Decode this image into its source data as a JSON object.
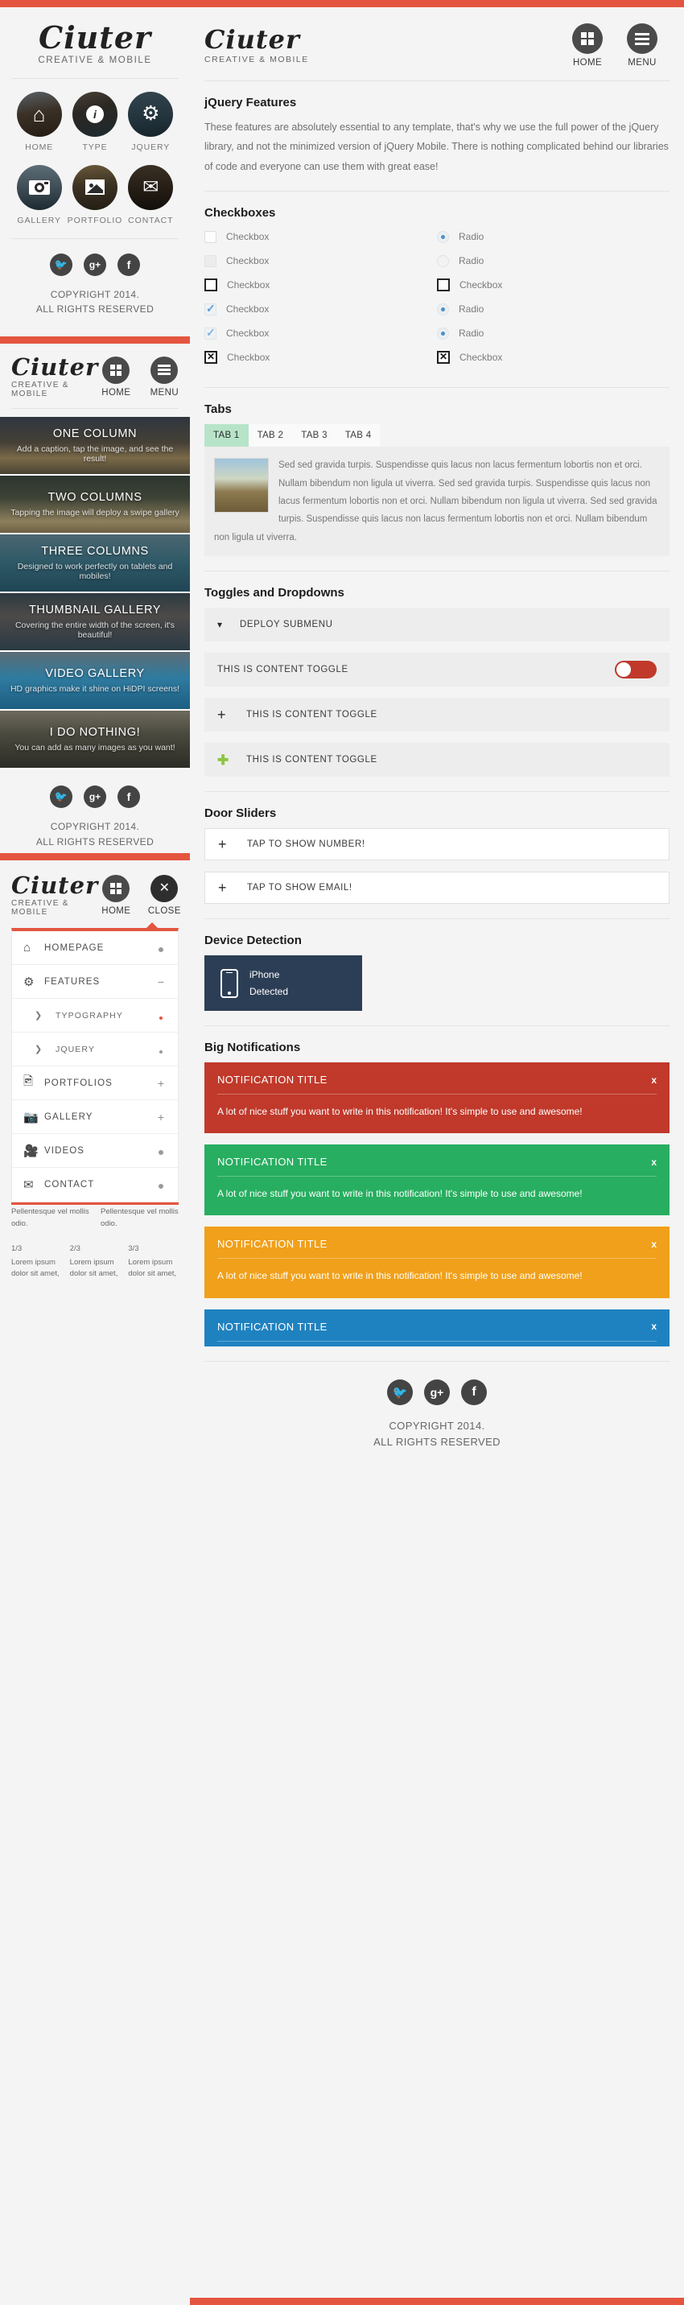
{
  "brand": {
    "name": "Ciuter",
    "tagline": "CREATIVE & MOBILE"
  },
  "colors": {
    "accent_red": "#e4553f",
    "notif_red": "#c0392b",
    "notif_green": "#27ae60",
    "notif_orange": "#f0a01a",
    "notif_blue": "#1f82c0",
    "tab_active_green": "#b7e4c9",
    "device_navy": "#2c3e55",
    "toggle_on_red": "#c0392b",
    "plus_green": "#8dc63f",
    "checkbox_blue": "#5b9bd5"
  },
  "page1": {
    "tiles": [
      {
        "label": "HOME",
        "icon": "home-icon",
        "glyph": "⌂"
      },
      {
        "label": "TYPE",
        "icon": "info-icon",
        "glyph": "i"
      },
      {
        "label": "JQUERY",
        "icon": "gear-icon",
        "glyph": "⚙"
      },
      {
        "label": "GALLERY",
        "icon": "camera-icon",
        "glyph": "▣"
      },
      {
        "label": "PORTFOLIO",
        "icon": "image-icon",
        "glyph": "⛰"
      },
      {
        "label": "CONTACT",
        "icon": "envelope-icon",
        "glyph": "✉"
      }
    ],
    "social": [
      {
        "name": "twitter-icon",
        "glyph": "🐦"
      },
      {
        "name": "google-plus-icon",
        "glyph": "g+"
      },
      {
        "name": "facebook-icon",
        "glyph": "f"
      }
    ],
    "copyright_line1": "COPYRIGHT 2014.",
    "copyright_line2": "ALL RIGHTS RESERVED"
  },
  "page2": {
    "nav": [
      {
        "label": "HOME",
        "icon": "grid-icon"
      },
      {
        "label": "MENU",
        "icon": "hamburger-icon"
      }
    ],
    "banners": [
      {
        "title": "ONE COLUMN",
        "subtitle": "Add a caption, tap the image, and see the result!"
      },
      {
        "title": "TWO COLUMNS",
        "subtitle": "Tapping the image will deploy a swipe gallery"
      },
      {
        "title": "THREE COLUMNS",
        "subtitle": "Designed to work perfectly on tablets and mobiles!"
      },
      {
        "title": "THUMBNAIL GALLERY",
        "subtitle": "Covering the entire width of the screen, it's beautiful!"
      },
      {
        "title": "VIDEO GALLERY",
        "subtitle": "HD graphics make it shine on HiDPI screens!"
      },
      {
        "title": "I DO NOTHING!",
        "subtitle": "You can add as many images as you want!"
      }
    ],
    "social": [
      {
        "name": "twitter-icon",
        "glyph": "🐦"
      },
      {
        "name": "google-plus-icon",
        "glyph": "g+"
      },
      {
        "name": "facebook-icon",
        "glyph": "f"
      }
    ],
    "copyright_line1": "COPYRIGHT 2014.",
    "copyright_line2": "ALL RIGHTS RESERVED"
  },
  "page3": {
    "nav": [
      {
        "label": "HOME",
        "icon": "grid-icon"
      },
      {
        "label": "CLOSE",
        "icon": "close-icon"
      }
    ],
    "menu": [
      {
        "label": "HOMEPAGE",
        "icon": "home-icon",
        "right": "dot",
        "sub": false
      },
      {
        "label": "FEATURES",
        "icon": "gear-icon",
        "right": "minus",
        "sub": false
      },
      {
        "label": "TYPOGRAPHY",
        "icon": "chevron-right-icon",
        "right": "dot-red",
        "sub": true
      },
      {
        "label": "JQUERY",
        "icon": "chevron-right-icon",
        "right": "dot-sm",
        "sub": true
      },
      {
        "label": "PORTFOLIOS",
        "icon": "image-icon",
        "right": "plus",
        "sub": false
      },
      {
        "label": "GALLERY",
        "icon": "camera-icon",
        "right": "plus",
        "sub": false
      },
      {
        "label": "VIDEOS",
        "icon": "video-icon",
        "right": "dot",
        "sub": false
      },
      {
        "label": "CONTACT",
        "icon": "envelope-icon",
        "right": "dot",
        "sub": false
      }
    ],
    "below_columns_2": [
      "Pellentesque vel mollis odio.",
      "Pellentesque vel mollis odio."
    ],
    "below_columns_3": [
      {
        "label": "1/3",
        "text": "Lorem ipsum dolor sit amet,"
      },
      {
        "label": "2/3",
        "text": "Lorem ipsum dolor sit amet,"
      },
      {
        "label": "3/3",
        "text": "Lorem ipsum dolor sit amet,"
      }
    ]
  },
  "page4": {
    "nav": [
      {
        "label": "HOME",
        "icon": "grid-icon"
      },
      {
        "label": "MENU",
        "icon": "hamburger-icon"
      }
    ],
    "intro": {
      "title": "jQuery Features",
      "text": "These features are absolutely essential to any template, that's why we use the full power of the jQuery library, and not the minimized version of jQuery Mobile. There is nothing complicated behind our libraries of code and everyone can use them with great ease!"
    },
    "checkboxes": {
      "title": "Checkboxes",
      "left": [
        {
          "type": "checkbox",
          "state": "empty-soft",
          "label": "Checkbox"
        },
        {
          "type": "checkbox",
          "state": "fill-soft",
          "label": "Checkbox"
        },
        {
          "type": "checkbox",
          "state": "hard",
          "label": "Checkbox"
        },
        {
          "type": "checkbox",
          "state": "checked",
          "label": "Checkbox"
        },
        {
          "type": "checkbox",
          "state": "checked-pale",
          "label": "Checkbox"
        },
        {
          "type": "checkbox",
          "state": "xbox",
          "label": "Checkbox"
        }
      ],
      "right": [
        {
          "type": "radio",
          "state": "on",
          "label": "Radio"
        },
        {
          "type": "radio",
          "state": "off",
          "label": "Radio"
        },
        {
          "type": "checkbox",
          "state": "hard",
          "label": "Checkbox"
        },
        {
          "type": "radio",
          "state": "on",
          "label": "Radio"
        },
        {
          "type": "radio",
          "state": "on",
          "label": "Radio"
        },
        {
          "type": "checkbox",
          "state": "xbox",
          "label": "Checkbox"
        }
      ]
    },
    "tabs": {
      "title": "Tabs",
      "items": [
        {
          "label": "TAB 1",
          "active": true
        },
        {
          "label": "TAB 2",
          "active": false
        },
        {
          "label": "TAB 3",
          "active": false
        },
        {
          "label": "TAB 4",
          "active": false
        }
      ],
      "panel_text": "Sed sed gravida turpis. Suspendisse quis lacus non lacus fermentum lobortis non et orci. Nullam bibendum non ligula ut viverra. Sed sed gravida turpis. Suspendisse quis lacus non lacus fermentum lobortis non et orci. Nullam bibendum non ligula ut viverra. Sed sed gravida turpis. Suspendisse quis lacus non lacus fermentum lobortis non et orci. Nullam bibendum non ligula ut viverra."
    },
    "toggles": {
      "title": "Toggles and Dropdowns",
      "rows": [
        {
          "icon": "chevron-down-icon",
          "label": "DEPLOY SUBMENU",
          "control": "none"
        },
        {
          "icon": "none",
          "label": "THIS IS CONTENT TOGGLE",
          "control": "switch-on"
        },
        {
          "icon": "plus-icon",
          "label": "THIS IS CONTENT TOGGLE",
          "control": "none"
        },
        {
          "icon": "plus-green-icon",
          "label": "THIS IS CONTENT TOGGLE",
          "control": "none"
        }
      ]
    },
    "doors": {
      "title": "Door Sliders",
      "rows": [
        {
          "icon": "plus-icon",
          "label": "TAP TO SHOW NUMBER!"
        },
        {
          "icon": "plus-icon",
          "label": "TAP TO SHOW EMAIL!"
        }
      ]
    },
    "device": {
      "title": "Device Detection",
      "line1": "iPhone",
      "line2": "Detected",
      "icon": "phone-icon"
    },
    "notifications": {
      "title": "Big Notifications",
      "items": [
        {
          "title": "NOTIFICATION TITLE",
          "body": "A lot of nice stuff you want to write in this notification! It's simple to use and awesome!",
          "color": "#c0392b",
          "close": "x",
          "collapsed": false
        },
        {
          "title": "NOTIFICATION TITLE",
          "body": "A lot of nice stuff you want to write in this notification! It's simple to use and awesome!",
          "color": "#27ae60",
          "close": "x",
          "collapsed": false
        },
        {
          "title": "NOTIFICATION TITLE",
          "body": "A lot of nice stuff you want to write in this notification! It's simple to use and awesome!",
          "color": "#f0a01a",
          "close": "x",
          "collapsed": false
        },
        {
          "title": "NOTIFICATION TITLE",
          "body": "",
          "color": "#1f82c0",
          "close": "x",
          "collapsed": true
        }
      ]
    },
    "social": [
      {
        "name": "twitter-icon",
        "glyph": "🐦"
      },
      {
        "name": "google-plus-icon",
        "glyph": "g+"
      },
      {
        "name": "facebook-icon",
        "glyph": "f"
      }
    ],
    "copyright_line1": "COPYRIGHT 2014.",
    "copyright_line2": "ALL RIGHTS RESERVED"
  }
}
